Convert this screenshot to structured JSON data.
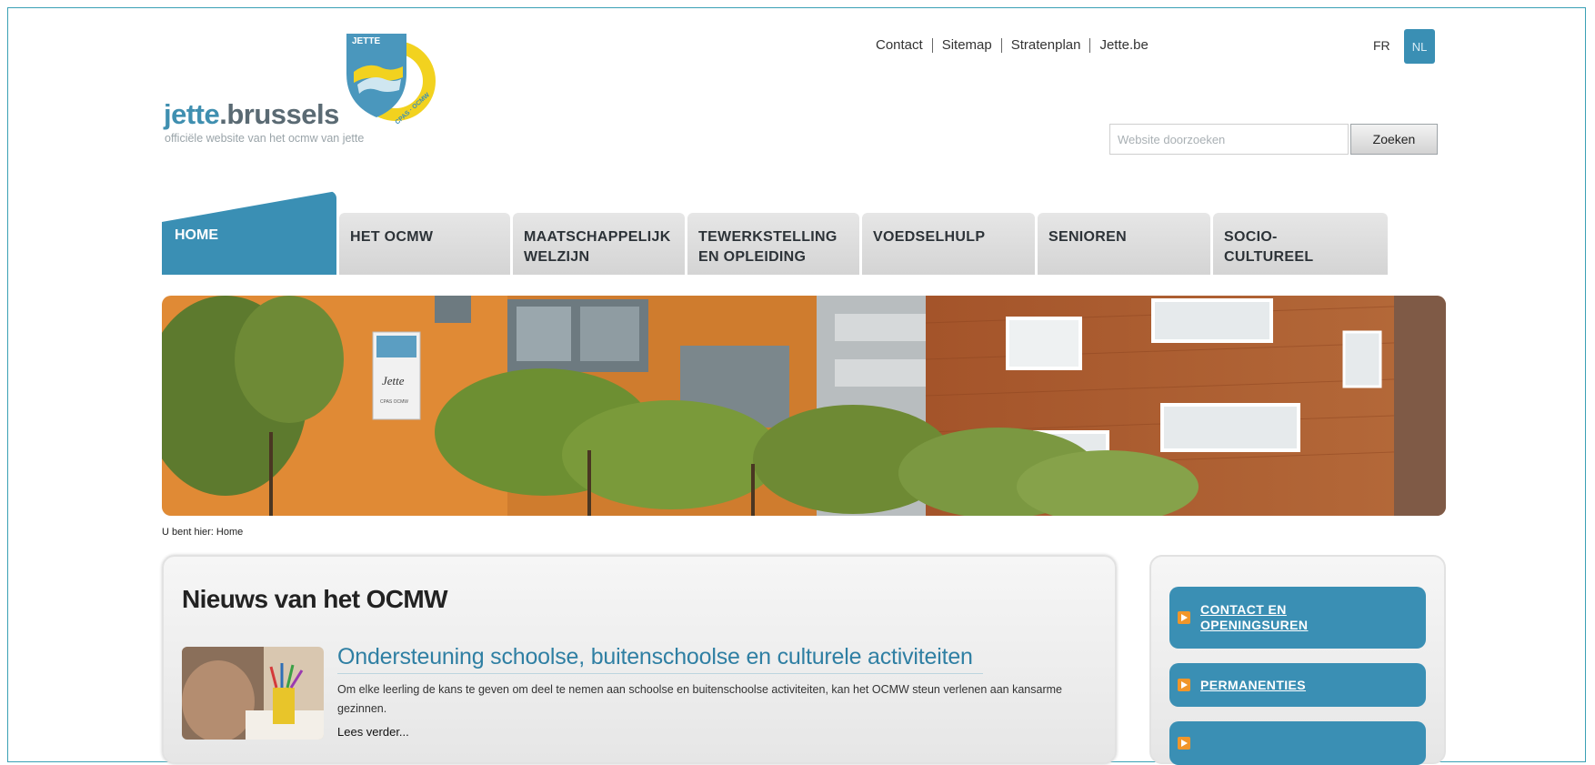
{
  "logo": {
    "badge_text": "JETTE",
    "ring_text": "CPAS · OCMW",
    "name_main": "jette",
    "name_rest": ".brussels",
    "tagline": "officiële website van het ocmw van jette"
  },
  "top_links": [
    "Contact",
    "Sitemap",
    "Stratenplan",
    "Jette.be"
  ],
  "languages": {
    "fr": "FR",
    "nl": "NL",
    "active": "NL"
  },
  "search": {
    "placeholder": "Website doorzoeken",
    "button": "Zoeken"
  },
  "nav": {
    "home": "HOME",
    "tabs": [
      [
        "HET OCMW"
      ],
      [
        "MAATSCHAPPELIJK",
        "WELZIJN"
      ],
      [
        "TEWERKSTELLING",
        "EN OPLEIDING"
      ],
      [
        "VOEDSELHULP"
      ],
      [
        "SENIOREN"
      ],
      [
        "SOCIO-",
        "CULTUREEL"
      ]
    ]
  },
  "hero": {
    "sign_text_1": "Jette",
    "sign_text_2": "CPAS OCMW"
  },
  "breadcrumb": "U bent hier: Home",
  "news": {
    "heading": "Nieuws van het OCMW",
    "article_title": "Ondersteuning schoolse, buitenschoolse en culturele activiteiten",
    "article_text": "Om elke leerling de kans te geven om deel te nemen aan schoolse en buitenschoolse activiteiten, kan het OCMW steun verlenen aan kansarme gezinnen.",
    "read_more": "Lees verder..."
  },
  "sidebar": {
    "buttons": [
      [
        "CONTACT EN",
        "OPENINGSUREN"
      ],
      [
        "PERMANENTIES"
      ]
    ]
  },
  "colors": {
    "brand_blue": "#3a8fb4",
    "accent_orange": "#f0962a",
    "accent_yellow": "#f2d21f"
  }
}
